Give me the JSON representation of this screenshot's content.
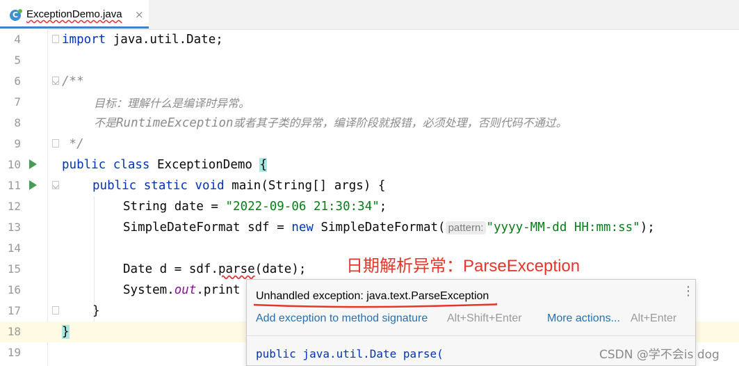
{
  "tab": {
    "icon_letter": "C",
    "file_name": "ExceptionDemo.java",
    "close_glyph": "×"
  },
  "lines": [
    {
      "no": "4"
    },
    {
      "no": "5"
    },
    {
      "no": "6"
    },
    {
      "no": "7"
    },
    {
      "no": "8"
    },
    {
      "no": "9"
    },
    {
      "no": "10"
    },
    {
      "no": "11"
    },
    {
      "no": "12"
    },
    {
      "no": "13"
    },
    {
      "no": "14"
    },
    {
      "no": "15"
    },
    {
      "no": "16"
    },
    {
      "no": "17"
    },
    {
      "no": "18"
    },
    {
      "no": "19"
    }
  ],
  "code": {
    "l4_kw": "import",
    "l4_rest": " java.util.Date;",
    "l6": "/**",
    "l7": "目标：理解什么是编译时异常。",
    "l8_a": "不是",
    "l8_b": "RuntimeException",
    "l8_c": "或者其子类的异常，编译阶段就报错，必须处理，否则代码不通过。",
    "l9": " */",
    "l10_kw": "public class",
    "l10_name": " ExceptionDemo ",
    "l10_brace": "{",
    "l11_kw": "public static void",
    "l11_rest": " main(String[] args) {",
    "l12_a": "String date = ",
    "l12_str": "\"2022-09-06 21:30:34\"",
    "l12_end": ";",
    "l13_a": "SimpleDateFormat sdf = ",
    "l13_kw": "new",
    "l13_b": " SimpleDateFormat(",
    "l13_hint": "pattern:",
    "l13_str": "\"yyyy-MM-dd HH:mm:ss\"",
    "l13_end": ");",
    "l15_a": "Date d = sdf.",
    "l15_m": "parse",
    "l15_b": "(date);",
    "l16_a": "System.",
    "l16_out": "out",
    "l16_b": ".print",
    "l17": "}",
    "l18": "}"
  },
  "annotation": "日期解析异常：ParseException",
  "popup": {
    "title": "Unhandled exception: java.text.ParseException",
    "kebab": "⋮",
    "action1": "Add exception to method signature",
    "shortcut1": "Alt+Shift+Enter",
    "action2": "More actions...",
    "shortcut2": "Alt+Enter",
    "doc_preview": "public java.util.Date parse("
  },
  "watermark": "CSDN @学不会is dog",
  "colors": {
    "keyword": "#0033b3",
    "string": "#067d17",
    "comment": "#8c8c8c",
    "annotation_red": "#e8352a",
    "run_icon": "#499c54",
    "tab_accent": "#4083c9"
  },
  "icons": [
    "class-file-icon",
    "close-icon",
    "run-gutter-icon",
    "fold-marker-icon",
    "more-options-icon"
  ]
}
